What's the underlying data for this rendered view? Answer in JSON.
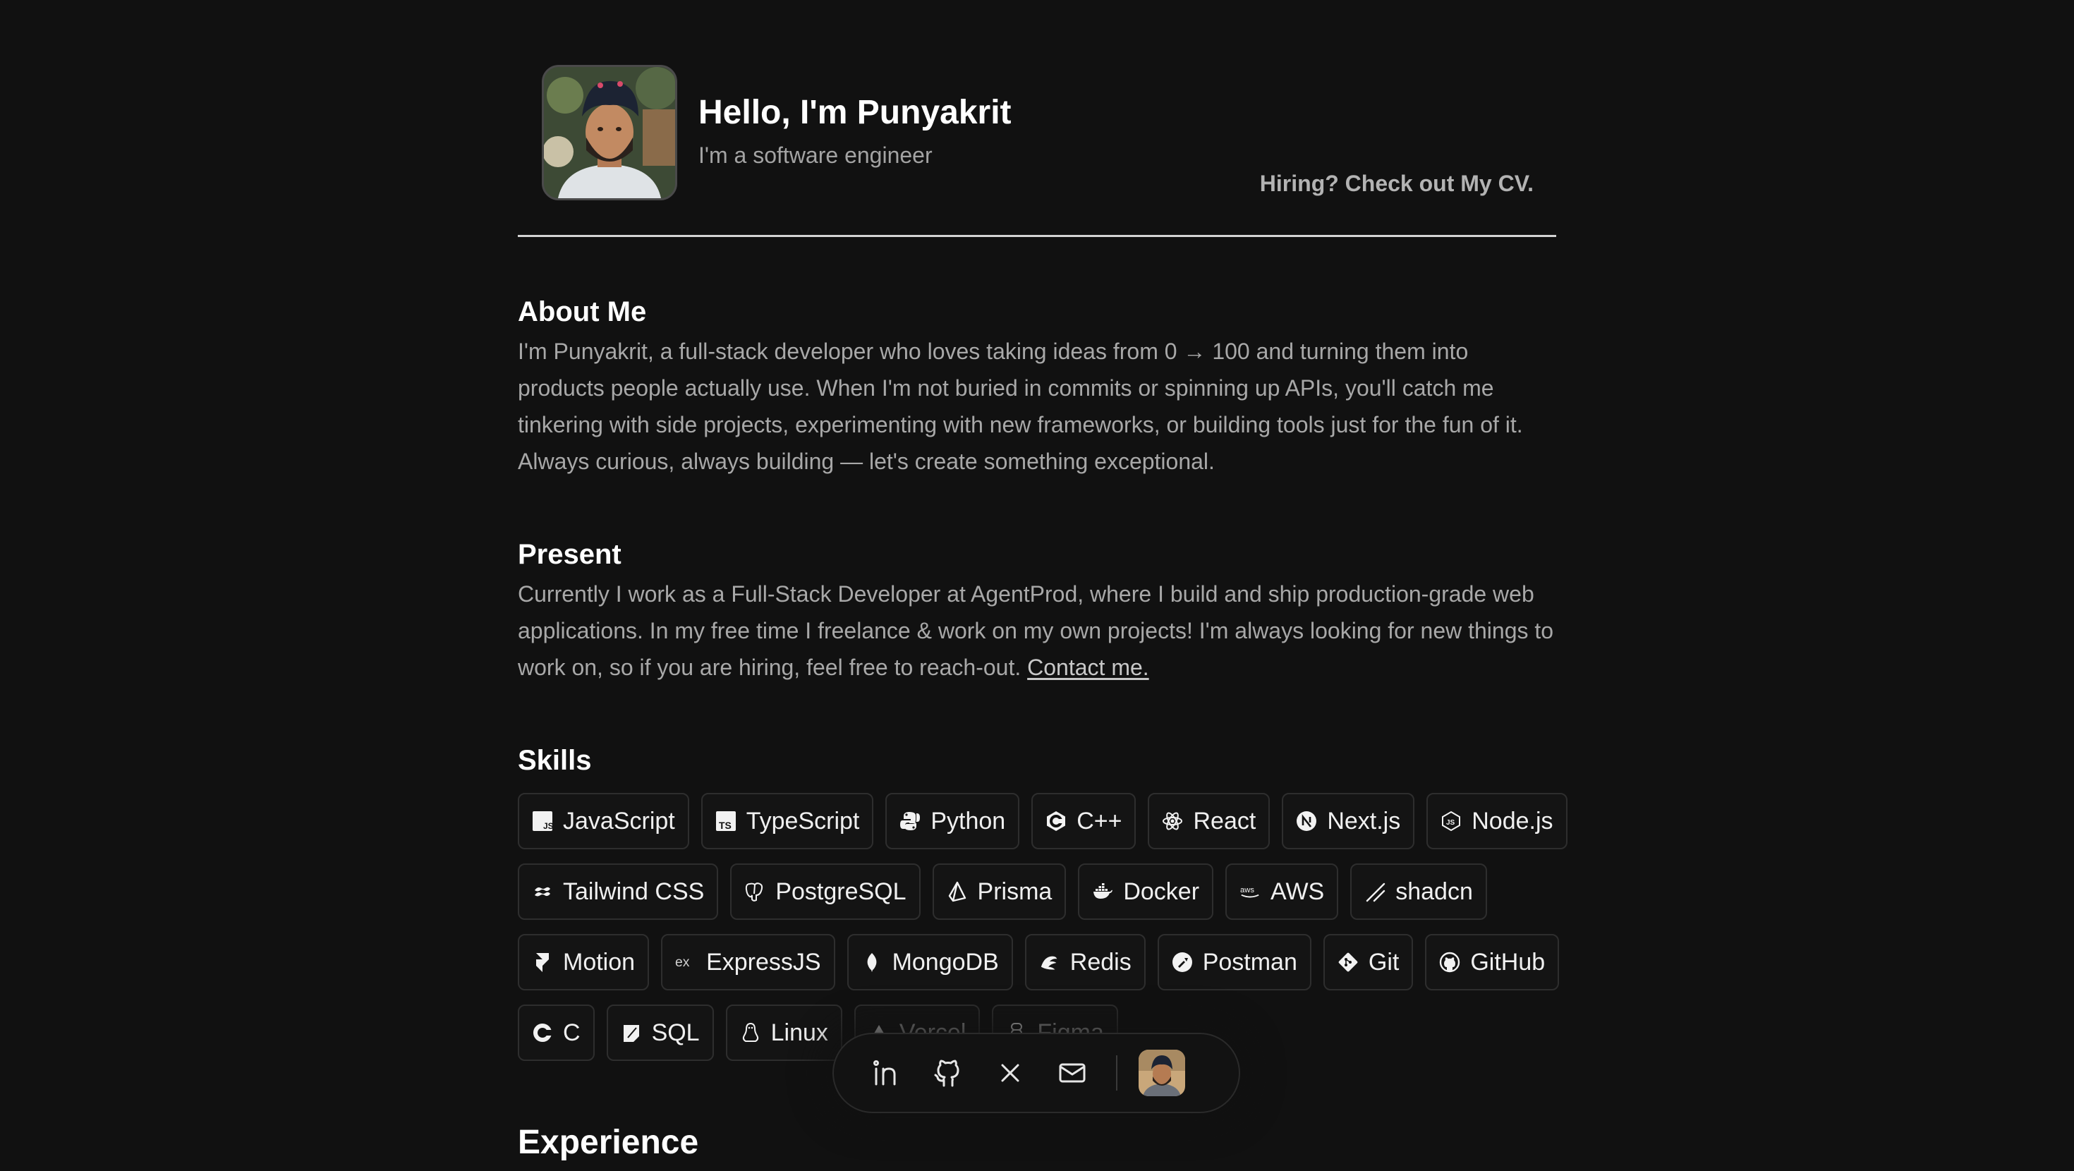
{
  "header": {
    "title": "Hello, I'm Punyakrit",
    "subtitle": "I'm a software engineer",
    "cv_link": "Hiring? Check out My CV."
  },
  "about": {
    "title": "About Me",
    "text": "I'm Punyakrit, a full-stack developer who loves taking ideas from 0 → 100 and turning them into products people actually use. When I'm not buried in commits or spinning up APIs, you'll catch me tinkering with side projects, experimenting with new frameworks, or building tools just for the fun of it. Always curious, always building — let's create something exceptional."
  },
  "present": {
    "title": "Present",
    "text": "Currently I work as a Full-Stack Developer at AgentProd, where I build and ship production-grade web applications. In my free time I freelance & work on my own projects! I'm always looking for new things to work on, so if you are hiring, feel free to reach-out. ",
    "contact_link": "Contact me."
  },
  "skills": {
    "title": "Skills",
    "rows": [
      [
        {
          "label": "JavaScript",
          "icon": "javascript-icon"
        },
        {
          "label": "TypeScript",
          "icon": "typescript-icon"
        },
        {
          "label": "Python",
          "icon": "python-icon"
        },
        {
          "label": "C++",
          "icon": "cplusplus-icon"
        },
        {
          "label": "React",
          "icon": "react-icon"
        },
        {
          "label": "Next.js",
          "icon": "nextjs-icon"
        },
        {
          "label": "Node.js",
          "icon": "nodejs-icon"
        }
      ],
      [
        {
          "label": "Tailwind CSS",
          "icon": "tailwind-icon"
        },
        {
          "label": "PostgreSQL",
          "icon": "postgresql-icon"
        },
        {
          "label": "Prisma",
          "icon": "prisma-icon"
        },
        {
          "label": "Docker",
          "icon": "docker-icon"
        },
        {
          "label": "AWS",
          "icon": "aws-icon"
        },
        {
          "label": "shadcn",
          "icon": "shadcn-icon"
        }
      ],
      [
        {
          "label": "Motion",
          "icon": "motion-icon"
        },
        {
          "label": "ExpressJS",
          "icon": "express-icon"
        },
        {
          "label": "MongoDB",
          "icon": "mongodb-icon"
        },
        {
          "label": "Redis",
          "icon": "redis-icon"
        },
        {
          "label": "Postman",
          "icon": "postman-icon"
        },
        {
          "label": "Git",
          "icon": "git-icon"
        },
        {
          "label": "GitHub",
          "icon": "github-icon"
        }
      ],
      [
        {
          "label": "C",
          "icon": "c-icon"
        },
        {
          "label": "SQL",
          "icon": "sql-icon"
        },
        {
          "label": "Linux",
          "icon": "linux-icon"
        },
        {
          "label": "Vercel",
          "icon": "vercel-icon"
        },
        {
          "label": "Figma",
          "icon": "figma-icon"
        }
      ]
    ]
  },
  "experience": {
    "title": "Experience"
  },
  "dock": {
    "items": [
      "linkedin-icon",
      "github-icon",
      "x-icon",
      "mail-icon"
    ]
  }
}
